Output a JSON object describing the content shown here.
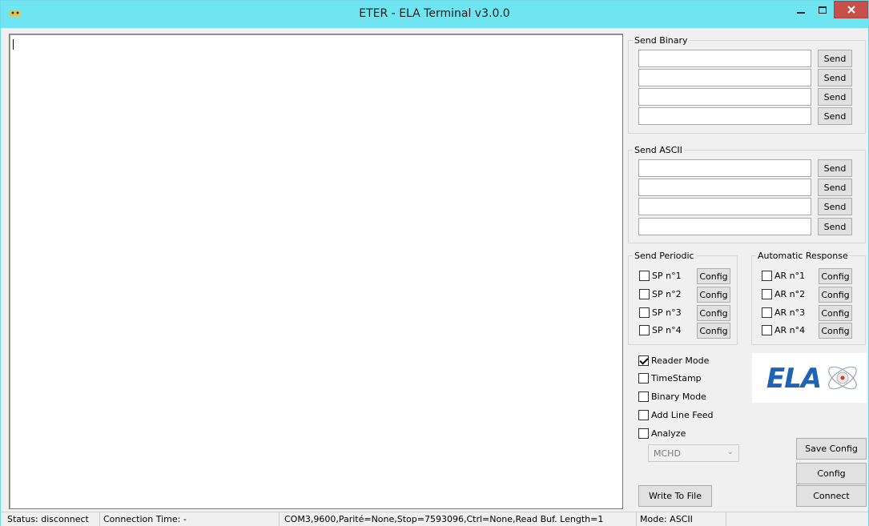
{
  "window": {
    "title": "ETER - ELA Terminal v3.0.0",
    "titlebar_color": "#6ee5f0",
    "close_color": "#c7504a"
  },
  "terminal": {
    "content": ""
  },
  "send_binary": {
    "label": "Send Binary",
    "rows": [
      {
        "value": "",
        "button": "Send"
      },
      {
        "value": "",
        "button": "Send"
      },
      {
        "value": "",
        "button": "Send"
      },
      {
        "value": "",
        "button": "Send"
      }
    ]
  },
  "send_ascii": {
    "label": "Send ASCII",
    "rows": [
      {
        "value": "",
        "button": "Send"
      },
      {
        "value": "",
        "button": "Send"
      },
      {
        "value": "",
        "button": "Send"
      },
      {
        "value": "",
        "button": "Send"
      }
    ]
  },
  "send_periodic": {
    "label": "Send Periodic",
    "items": [
      {
        "label": "SP n°1",
        "checked": false,
        "button": "Config"
      },
      {
        "label": "SP n°2",
        "checked": false,
        "button": "Config"
      },
      {
        "label": "SP n°3",
        "checked": false,
        "button": "Config"
      },
      {
        "label": "SP n°4",
        "checked": false,
        "button": "Config"
      }
    ]
  },
  "automatic_response": {
    "label": "Automatic Response",
    "items": [
      {
        "label": "AR n°1",
        "checked": false,
        "button": "Config"
      },
      {
        "label": "AR n°2",
        "checked": false,
        "button": "Config"
      },
      {
        "label": "AR n°3",
        "checked": false,
        "button": "Config"
      },
      {
        "label": "AR n°4",
        "checked": false,
        "button": "Config"
      }
    ]
  },
  "options": [
    {
      "label": "Reader Mode",
      "checked": true
    },
    {
      "label": "TimeStamp",
      "checked": false
    },
    {
      "label": "Binary Mode",
      "checked": false
    },
    {
      "label": "Add Line Feed",
      "checked": false
    },
    {
      "label": "Analyze",
      "checked": false
    }
  ],
  "analyze_mode": {
    "selected": "MCHD",
    "icon": "chevron-down-icon"
  },
  "logo": {
    "text": "ELA",
    "color": "#1f63b4"
  },
  "buttons": {
    "save_config": "Save Config",
    "config": "Config",
    "write_to_file": "Write To File",
    "connect": "Connect"
  },
  "status_bar": {
    "status": "Status: disconnect",
    "connection_time": "Connection Time: -",
    "port_settings": "COM3,9600,Parité=None,Stop=7593096,Ctrl=None,Read Buf. Length=1",
    "mode": "Mode: ASCII"
  }
}
